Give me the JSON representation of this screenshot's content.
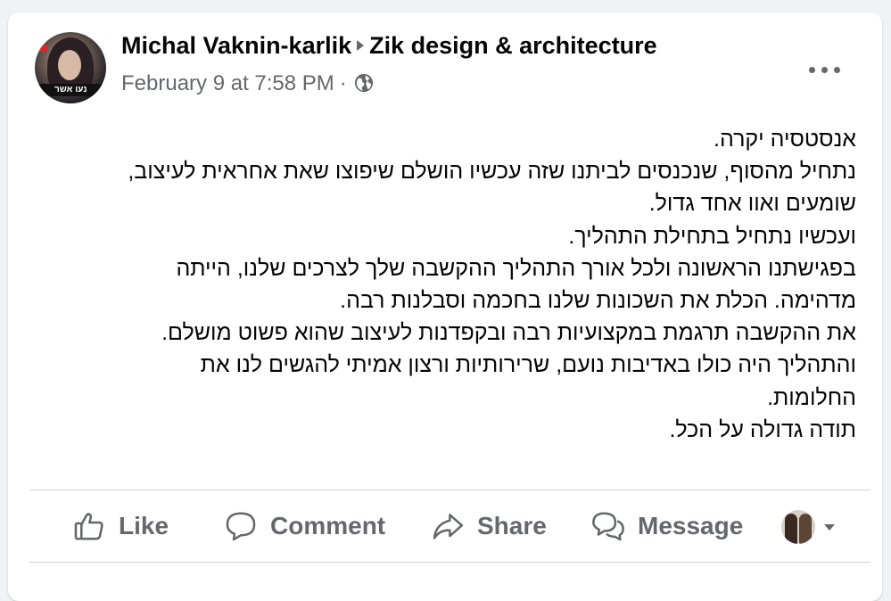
{
  "post": {
    "author": "Michal Vaknin-karlik",
    "page": "Zik design & architecture",
    "timestamp": "February 9 at 7:58 PM",
    "separator": "·",
    "privacy_icon": "globe-icon",
    "avatar_badge": "נעו אשר"
  },
  "body": {
    "lines": [
      "אנסטסיה יקרה.",
      "נתחיל מהסוף, שנכנסים לביתנו שזה עכשיו הושלם שיפוצו שאת אחראית לעיצוב,",
      "שומעים ואוו אחד גדול.",
      "ועכשיו נתחיל בתחילת התהליך.",
      "בפגישתנו הראשונה ולכל אורך התהליך ההקשבה שלך לצרכים שלנו, הייתה",
      "מדהימה. הכלת את השכונות שלנו בחכמה וסבלנות רבה.",
      "את ההקשבה תרגמת במקצועיות רבה ובקפדנות לעיצוב שהוא פשוט מושלם.",
      "והתהליך היה כולו באדיבות נועם, שרירותיות ורצון אמיתי להגשים לנו את",
      "החלומות.",
      "תודה גדולה על הכל."
    ]
  },
  "actions": {
    "like": "Like",
    "comment": "Comment",
    "share": "Share",
    "message": "Message"
  },
  "icons": {
    "like": "thumbs-up-icon",
    "comment": "speech-bubble-icon",
    "share": "share-arrow-icon",
    "message": "messenger-icon",
    "more": "more-dots-icon"
  },
  "colors": {
    "text": "#050505",
    "secondary": "#65676b",
    "divider": "#ced0d4",
    "background": "#f0f2f5",
    "card": "#ffffff"
  }
}
